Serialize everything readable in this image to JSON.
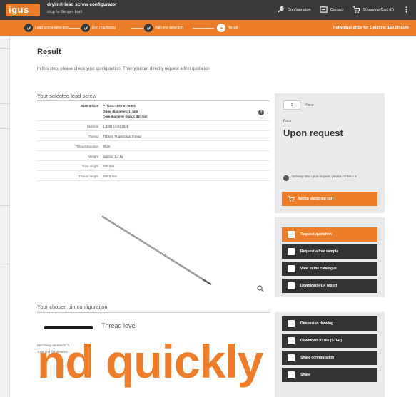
{
  "header": {
    "logo": "igus",
    "title": "drylin® lead screw configurator",
    "subtitle": "shop for Gengen Kraft",
    "nav": [
      {
        "icon": "wrench-icon",
        "label": "Configuration"
      },
      {
        "icon": "contact-icon",
        "label": "Contact"
      },
      {
        "icon": "cart-icon",
        "label": "Shopping Cart (0)"
      }
    ]
  },
  "steps": [
    {
      "label": "Lead screw selection",
      "active": false
    },
    {
      "label": "End machining",
      "active": false
    },
    {
      "label": "Add-ons selection",
      "active": false
    },
    {
      "label": "Result",
      "active": true
    }
  ],
  "step_price_note": "Individual price for 1 pieces: 150.00 EUR",
  "main": {
    "title": "Result",
    "intro": "In this step, please check your configuration. Then you can directly request a firm quotation",
    "selected_title": "Your selected lead screw",
    "specs": [
      {
        "label": "Base article",
        "value": "PTGSG-1050-01-R-ES",
        "bold": true
      },
      {
        "label": "",
        "value": "Outer diameter d1: mm",
        "bold": true
      },
      {
        "label": "",
        "value": "Core diameter (min.): d3: mm",
        "bold": true
      },
      {
        "label": "Material",
        "value": "1.4301 (AISI 304)",
        "bold": false
      },
      {
        "label": "Thread",
        "value": "Tr10x4, Trapezoidal thread",
        "bold": false
      },
      {
        "label": "Thread direction",
        "value": "Right",
        "bold": false
      },
      {
        "label": "Weight",
        "value": "approx. 1.4 kg",
        "bold": false
      },
      {
        "label": "Total length",
        "value": "500 mm",
        "bold": false
      },
      {
        "label": "Thread length",
        "value": "500.0 mm",
        "bold": false
      }
    ],
    "pin_title": "Your chosen pin configuration",
    "pin_label": "Thread level",
    "machining_note": "Machining elements: 0",
    "tolerance_note": "Total and fit tolerance",
    "overlay": "nd quickly"
  },
  "price_panel": {
    "qty": "1",
    "unit": "Piece",
    "price_label": "Price",
    "price": "Upon request",
    "delivery": "Delivery time upon request, please contact us",
    "cart_button": "Add to shopping cart"
  },
  "actions": [
    {
      "label": "Request quotation",
      "orange": true
    },
    {
      "label": "Request a free sample",
      "orange": false
    },
    {
      "label": "View in the catalogue",
      "orange": false
    },
    {
      "label": "Download PDF report",
      "orange": false
    }
  ],
  "actions2": [
    {
      "label": "Dimension drawing"
    },
    {
      "label": "Download 3D file (STEP)"
    },
    {
      "label": "Share configuration"
    },
    {
      "label": "Share"
    }
  ],
  "colors": {
    "accent": "#ee7d2a",
    "dark": "#3a3a3a",
    "panel": "#eaeaea"
  }
}
